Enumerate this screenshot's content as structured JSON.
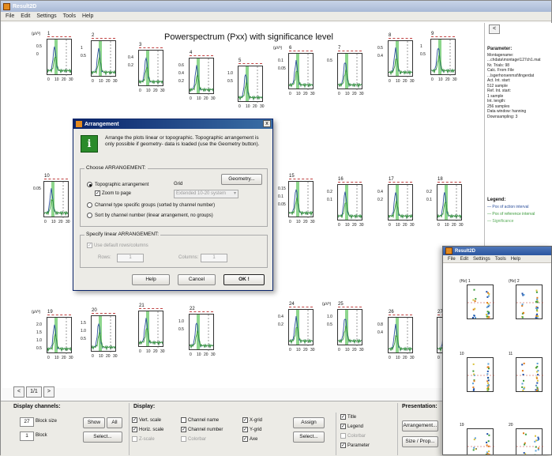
{
  "main_window": {
    "title": "Result2D",
    "menu": [
      "File",
      "Edit",
      "Settings",
      "Tools",
      "Help"
    ],
    "plot_title": "Powerspectrum (Pxx) with significance level"
  },
  "topo_plots": [
    {
      "label": "1",
      "unit": "(μV²)",
      "ticks": [
        "0.5",
        "0"
      ]
    },
    {
      "label": "2",
      "unit": "",
      "ticks": [
        "1",
        "0.5"
      ]
    },
    {
      "label": "3",
      "unit": "",
      "ticks": [
        "0.4",
        "0.2"
      ]
    },
    {
      "label": "4",
      "unit": "",
      "ticks": [
        "0.6",
        "0.4",
        "0.2"
      ]
    },
    {
      "label": "5",
      "unit": "",
      "ticks": [
        "1.0",
        "0.5"
      ]
    },
    {
      "label": "6",
      "unit": "(μV²)",
      "ticks": [
        "0.1",
        "0.05"
      ]
    },
    {
      "label": "7",
      "unit": "",
      "ticks": [
        "0.5"
      ]
    },
    {
      "label": "8",
      "unit": "",
      "ticks": [
        "0.5",
        "0.4"
      ]
    },
    {
      "label": "9",
      "unit": "",
      "ticks": [
        "1",
        "0.5"
      ]
    },
    {
      "label": "10",
      "unit": "",
      "ticks": [
        "0.05"
      ]
    },
    {
      "label": "15",
      "unit": "",
      "ticks": [
        "0.15",
        "0.1",
        "0.05"
      ]
    },
    {
      "label": "16",
      "unit": "",
      "ticks": [
        "0.2",
        "0.1"
      ]
    },
    {
      "label": "17",
      "unit": "",
      "ticks": [
        "0.4",
        "0.2"
      ]
    },
    {
      "label": "18",
      "unit": "",
      "ticks": [
        "0.2",
        "0.1"
      ]
    },
    {
      "label": "19",
      "unit": "(μV²)",
      "ticks": [
        "2.0",
        "1.5",
        "1.0",
        "0.5"
      ]
    },
    {
      "label": "20",
      "unit": "",
      "ticks": [
        "1.5",
        "1.0",
        "0.5"
      ]
    },
    {
      "label": "21",
      "unit": "",
      "ticks": []
    },
    {
      "label": "22",
      "unit": "",
      "ticks": [
        "1.0",
        "0.5"
      ]
    },
    {
      "label": "24",
      "unit": "",
      "ticks": [
        "0.4",
        "0.2"
      ]
    },
    {
      "label": "25",
      "unit": "(μV²)",
      "ticks": [
        "1.0",
        "0.5"
      ]
    },
    {
      "label": "26",
      "unit": "",
      "ticks": [
        "0.8",
        "0.4"
      ]
    },
    {
      "label": "27",
      "unit": "",
      "ticks": []
    }
  ],
  "x_ticks": [
    "0",
    "10",
    "20",
    "30"
  ],
  "right_panel": {
    "button": "<",
    "param_header": "Parameter:",
    "param_lines": [
      "Montagename:",
      "...chdata\\montage\\127ch1.mat",
      "Nr. Trials: 98",
      "Calc. From File",
      "...lsgerhorsenmst\\fingerdat",
      "Act. Int. start:",
      "512 sample",
      "Ref. Int. start:",
      "1 sample",
      "Int. length:",
      "256 samples",
      "Data window: hanning",
      "Downsampling: 3"
    ],
    "legend_header": "Legend:",
    "legend_items": [
      "— Pxx of action interval",
      "— Pxx of reference interval",
      "— Significance"
    ]
  },
  "pager": {
    "prev": "<",
    "page": "1/1",
    "next": ">"
  },
  "display_channels": {
    "title": "Display channels:",
    "block_size_value": "27",
    "block_size_label": "Block size",
    "block_value": "1",
    "block_label": "Block",
    "show": "Show",
    "all": "All",
    "select": "Select..."
  },
  "display": {
    "title": "Display:",
    "checks": [
      {
        "label": "Vert. scale",
        "checked": true,
        "disabled": false
      },
      {
        "label": "Horiz. scale",
        "checked": true,
        "disabled": false
      },
      {
        "label": "Z-scale",
        "checked": false,
        "disabled": true
      },
      {
        "label": "Channel name",
        "checked": false,
        "disabled": false
      },
      {
        "label": "Channel number",
        "checked": true,
        "disabled": false
      },
      {
        "label": "Colorbar",
        "checked": false,
        "disabled": true
      },
      {
        "label": "X-grid",
        "checked": true,
        "disabled": false
      },
      {
        "label": "Y-grid",
        "checked": true,
        "disabled": false
      },
      {
        "label": "Axe",
        "checked": true,
        "disabled": false
      }
    ],
    "assign": "Assign",
    "select": "Select...",
    "checks2": [
      {
        "label": "Title",
        "checked": true,
        "disabled": false
      },
      {
        "label": "Legend",
        "checked": true,
        "disabled": false
      },
      {
        "label": "Colorbar",
        "checked": false,
        "disabled": true
      },
      {
        "label": "Parameter",
        "checked": true,
        "disabled": false
      }
    ]
  },
  "presentation": {
    "title": "Presentation:",
    "arrangement": "Arrangement...",
    "size_prop": "Size / Prop..."
  },
  "dialog": {
    "title": "Arrangement",
    "close": "x",
    "icon": "i",
    "text": "Arrange the plots linear or topographic. Topographic arrangement is only possible if geometry- data is loaded (use the Geometry button).",
    "group1_title": "Choose ARRANGEMENT:",
    "geometry": "Geometry...",
    "radio_topo": "Topographic arrangement",
    "zoom_to_page": "Zoom to page",
    "grid_label": "Grid",
    "grid_select": "Extended 10-20 system",
    "radio_channel_type": "Channel type specific groups (sorted by channel number)",
    "radio_sort": "Sort by channel number (linear arrangement, no groups)",
    "group2_title": "Specify linear ARRANGEMENT:",
    "use_default": "Use default rows/columns",
    "rows_label": "Rows:",
    "rows_value": "1",
    "columns_label": "Columns:",
    "columns_value": "1",
    "help": "Help",
    "cancel": "Cancel",
    "ok": "OK !"
  },
  "overlay_window": {
    "title": "Result2D",
    "menu": [
      "File",
      "Edit",
      "Settings",
      "Tools",
      "Help"
    ],
    "plots": [
      {
        "label": "1",
        "unit": "(Hz)"
      },
      {
        "label": "2",
        "unit": "(Hz)"
      },
      {
        "label": "10",
        "unit": ""
      },
      {
        "label": "11",
        "unit": ""
      },
      {
        "label": "19",
        "unit": ""
      },
      {
        "label": "20",
        "unit": ""
      }
    ]
  },
  "colors": {
    "act_line": "#2a4e9a",
    "ref_line": "#3a9a3a",
    "significance": "#8dd68d",
    "dialog_title": "#0a246a",
    "info_icon": "#2a8a2a"
  }
}
